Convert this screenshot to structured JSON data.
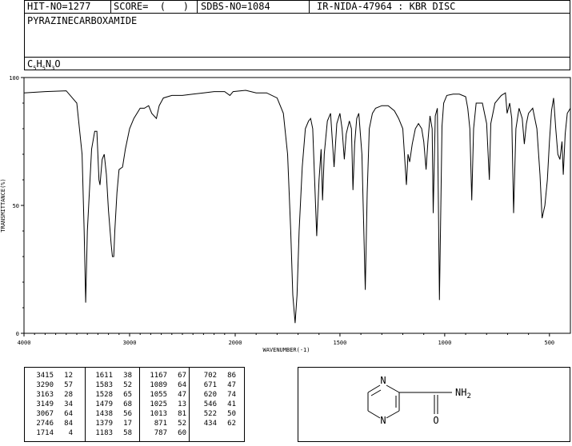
{
  "header": {
    "hit_no": "HIT-NO=1277",
    "score": "SCORE=  (   )",
    "sdbs_no": "SDBS-NO=1084",
    "ir_nida": "IR-NIDA-47964 : KBR DISC",
    "compound_name": "PYRAZINECARBOXAMIDE",
    "formula": {
      "c": "C",
      "c_n": "5",
      "h": "H",
      "h_n": "5",
      "n": "N",
      "n_n": "3",
      "o": "O"
    }
  },
  "chart_data": {
    "type": "line",
    "ylabel": "TRANSMITTANCE(%)",
    "xlabel": "WAVENUMBER(-1)",
    "x_ticks": [
      "4000",
      "3000",
      "2000",
      "1500",
      "1000",
      "500"
    ],
    "y_ticks": [
      "100",
      "50",
      "0"
    ],
    "xlim": [
      4000,
      400
    ],
    "ylim": [
      0,
      100
    ],
    "x_scale": "split: 4000-2000 compressed, 2000-400 expanded",
    "series": [
      {
        "points": [
          [
            4000,
            94
          ],
          [
            3800,
            94.5
          ],
          [
            3600,
            94.8
          ],
          [
            3500,
            90
          ],
          [
            3450,
            70
          ],
          [
            3430,
            40
          ],
          [
            3416,
            12
          ],
          [
            3400,
            40
          ],
          [
            3360,
            72
          ],
          [
            3330,
            79
          ],
          [
            3310,
            79
          ],
          [
            3290,
            60
          ],
          [
            3280,
            58
          ],
          [
            3260,
            68
          ],
          [
            3240,
            70
          ],
          [
            3220,
            62
          ],
          [
            3200,
            48
          ],
          [
            3175,
            35
          ],
          [
            3163,
            30
          ],
          [
            3150,
            30
          ],
          [
            3140,
            40
          ],
          [
            3120,
            55
          ],
          [
            3100,
            64
          ],
          [
            3067,
            65
          ],
          [
            3040,
            72
          ],
          [
            3000,
            80
          ],
          [
            2960,
            84
          ],
          [
            2900,
            88
          ],
          [
            2860,
            88
          ],
          [
            2820,
            89
          ],
          [
            2790,
            86
          ],
          [
            2746,
            84
          ],
          [
            2720,
            89
          ],
          [
            2680,
            92
          ],
          [
            2600,
            93
          ],
          [
            2500,
            93
          ],
          [
            2400,
            93.5
          ],
          [
            2300,
            94
          ],
          [
            2200,
            94.5
          ],
          [
            2100,
            94.5
          ],
          [
            2050,
            93
          ],
          [
            2020,
            94.5
          ],
          [
            1950,
            95
          ],
          [
            1900,
            94
          ],
          [
            1850,
            94
          ],
          [
            1800,
            92
          ],
          [
            1770,
            86
          ],
          [
            1750,
            70
          ],
          [
            1735,
            40
          ],
          [
            1725,
            15
          ],
          [
            1714,
            4
          ],
          [
            1705,
            15
          ],
          [
            1695,
            40
          ],
          [
            1680,
            65
          ],
          [
            1665,
            80
          ],
          [
            1650,
            83
          ],
          [
            1640,
            84
          ],
          [
            1630,
            80
          ],
          [
            1611,
            38
          ],
          [
            1600,
            60
          ],
          [
            1590,
            72
          ],
          [
            1583,
            52
          ],
          [
            1575,
            70
          ],
          [
            1560,
            83
          ],
          [
            1545,
            86
          ],
          [
            1528,
            65
          ],
          [
            1515,
            82
          ],
          [
            1500,
            86
          ],
          [
            1490,
            80
          ],
          [
            1479,
            68
          ],
          [
            1470,
            78
          ],
          [
            1455,
            83
          ],
          [
            1445,
            80
          ],
          [
            1438,
            56
          ],
          [
            1430,
            74
          ],
          [
            1420,
            84
          ],
          [
            1410,
            86
          ],
          [
            1395,
            70
          ],
          [
            1379,
            17
          ],
          [
            1370,
            55
          ],
          [
            1360,
            80
          ],
          [
            1345,
            86
          ],
          [
            1330,
            88
          ],
          [
            1300,
            89
          ],
          [
            1270,
            89
          ],
          [
            1240,
            87
          ],
          [
            1220,
            84
          ],
          [
            1200,
            80
          ],
          [
            1183,
            58
          ],
          [
            1175,
            70
          ],
          [
            1167,
            67
          ],
          [
            1155,
            74
          ],
          [
            1140,
            80
          ],
          [
            1125,
            82
          ],
          [
            1110,
            80
          ],
          [
            1100,
            75
          ],
          [
            1089,
            64
          ],
          [
            1080,
            75
          ],
          [
            1070,
            85
          ],
          [
            1060,
            80
          ],
          [
            1055,
            47
          ],
          [
            1045,
            85
          ],
          [
            1035,
            88
          ],
          [
            1025,
            13
          ],
          [
            1020,
            40
          ],
          [
            1013,
            81
          ],
          [
            1005,
            90
          ],
          [
            990,
            93
          ],
          [
            960,
            93.5
          ],
          [
            930,
            93.5
          ],
          [
            900,
            92.5
          ],
          [
            890,
            88
          ],
          [
            880,
            80
          ],
          [
            871,
            52
          ],
          [
            862,
            80
          ],
          [
            850,
            90
          ],
          [
            820,
            90
          ],
          [
            800,
            82
          ],
          [
            787,
            60
          ],
          [
            780,
            82
          ],
          [
            760,
            90
          ],
          [
            730,
            93
          ],
          [
            710,
            94
          ],
          [
            702,
            86
          ],
          [
            690,
            90
          ],
          [
            680,
            84
          ],
          [
            671,
            47
          ],
          [
            660,
            80
          ],
          [
            645,
            88
          ],
          [
            630,
            84
          ],
          [
            620,
            74
          ],
          [
            610,
            82
          ],
          [
            600,
            86
          ],
          [
            580,
            88
          ],
          [
            560,
            80
          ],
          [
            545,
            62
          ],
          [
            535,
            45
          ],
          [
            522,
            50
          ],
          [
            510,
            60
          ],
          [
            500,
            75
          ],
          [
            490,
            87
          ],
          [
            480,
            92
          ],
          [
            470,
            80
          ],
          [
            460,
            70
          ],
          [
            450,
            68
          ],
          [
            440,
            75
          ],
          [
            434,
            62
          ],
          [
            425,
            78
          ],
          [
            415,
            86
          ],
          [
            400,
            88
          ]
        ]
      }
    ]
  },
  "peaks": {
    "columns": [
      [
        [
          "3415",
          "12"
        ],
        [
          "3290",
          "57"
        ],
        [
          "3163",
          "28"
        ],
        [
          "3149",
          "34"
        ],
        [
          "3067",
          "64"
        ],
        [
          "2746",
          "84"
        ],
        [
          "1714",
          "4"
        ]
      ],
      [
        [
          "1611",
          "38"
        ],
        [
          "1583",
          "52"
        ],
        [
          "1528",
          "65"
        ],
        [
          "1479",
          "68"
        ],
        [
          "1438",
          "56"
        ],
        [
          "1379",
          "17"
        ],
        [
          "1183",
          "58"
        ]
      ],
      [
        [
          "1167",
          "67"
        ],
        [
          "1089",
          "64"
        ],
        [
          "1055",
          "47"
        ],
        [
          "1025",
          "13"
        ],
        [
          "1013",
          "81"
        ],
        [
          "871",
          "52"
        ],
        [
          "787",
          "60"
        ]
      ],
      [
        [
          "702",
          "86"
        ],
        [
          "671",
          "47"
        ],
        [
          "620",
          "74"
        ],
        [
          "546",
          "41"
        ],
        [
          "522",
          "50"
        ],
        [
          "434",
          "62"
        ],
        [
          "",
          ""
        ]
      ]
    ]
  },
  "structure": {
    "n_top": "N",
    "n_bottom": "N",
    "o": "O",
    "nh2": "NH",
    "nh2_sub": "2"
  }
}
